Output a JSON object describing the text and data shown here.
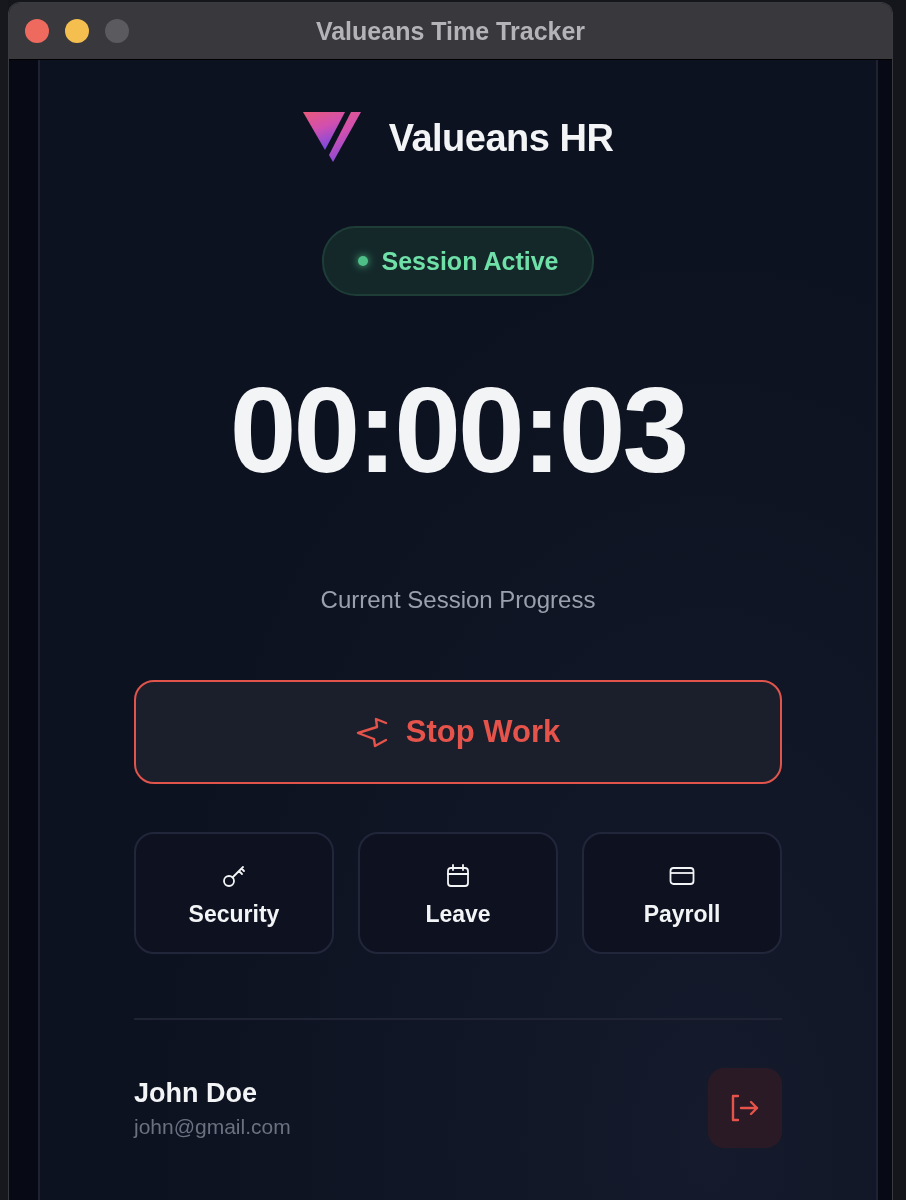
{
  "window": {
    "title": "Valueans Time Tracker"
  },
  "brand": {
    "name": "Valueans HR"
  },
  "status": {
    "label": "Session Active"
  },
  "timer": "00:00:03",
  "progress_label": "Current Session Progress",
  "stop_button": {
    "label": "Stop Work"
  },
  "actions": [
    {
      "label": "Security",
      "kind": "key"
    },
    {
      "label": "Leave",
      "kind": "calendar"
    },
    {
      "label": "Payroll",
      "kind": "card"
    }
  ],
  "user": {
    "name": "John Doe",
    "email": "john@gmail.com"
  }
}
